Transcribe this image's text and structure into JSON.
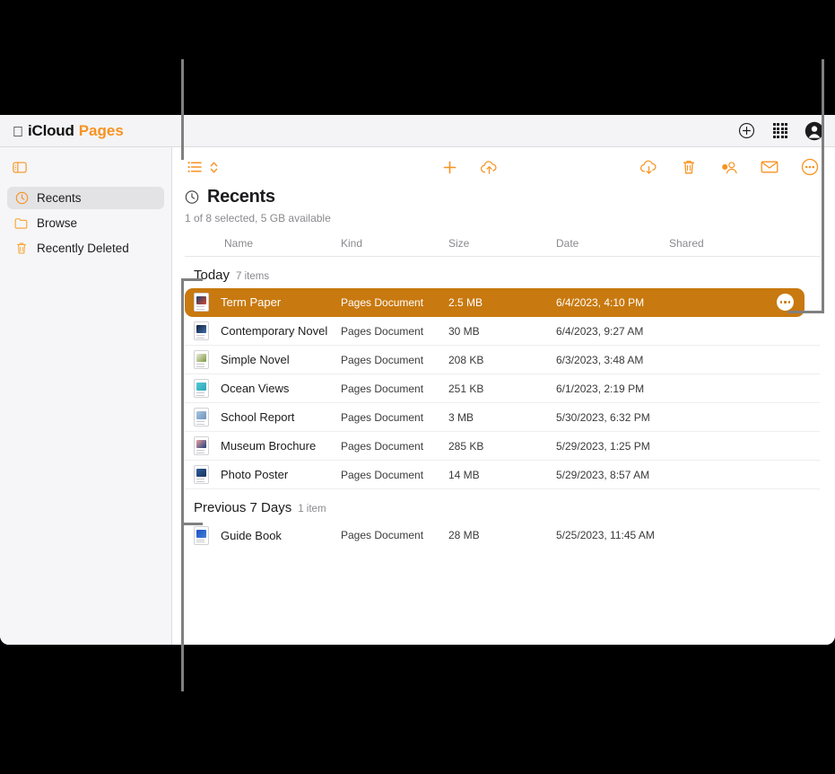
{
  "header": {
    "apple_logo": "",
    "brand_primary": "iCloud",
    "brand_app": "Pages",
    "icons": [
      {
        "name": "add-circle-icon",
        "label": "+"
      },
      {
        "name": "app-grid-icon",
        "label": "apps"
      },
      {
        "name": "account-avatar-icon",
        "label": "account"
      }
    ]
  },
  "sidebar": {
    "toggle_name": "sidebar-toggle-icon",
    "items": [
      {
        "label": "Recents",
        "icon": "clock-icon",
        "active": true
      },
      {
        "label": "Browse",
        "icon": "folder-icon",
        "active": false
      },
      {
        "label": "Recently Deleted",
        "icon": "trash-icon",
        "active": false
      }
    ]
  },
  "toolbar": {
    "left": [
      {
        "name": "list-view-icon",
        "label": "List view"
      },
      {
        "name": "sort-chevrons-icon",
        "label": "Sort"
      }
    ],
    "center": [
      {
        "name": "new-document-icon",
        "label": "+"
      },
      {
        "name": "cloud-upload-icon",
        "label": "Upload"
      }
    ],
    "right": [
      {
        "name": "cloud-download-icon",
        "label": "Download"
      },
      {
        "name": "delete-trash-icon",
        "label": "Delete"
      },
      {
        "name": "share-person-icon",
        "label": "Share"
      },
      {
        "name": "mail-envelope-icon",
        "label": "Mail"
      },
      {
        "name": "more-options-icon",
        "label": "More"
      }
    ]
  },
  "page": {
    "title": "Recents",
    "title_icon": "clock-icon",
    "subtitle": "1 of 8 selected, 5 GB available"
  },
  "columns": [
    "Name",
    "Kind",
    "Size",
    "Date",
    "Shared"
  ],
  "groups": [
    {
      "name": "Today",
      "count": "7 items",
      "files": [
        {
          "name": "Term Paper",
          "kind": "Pages Document",
          "size": "2.5 MB",
          "date": "6/4/2023, 4:10 PM",
          "shared": "",
          "selected": true,
          "thumb": "#1d3f6e",
          "thumb2": "#d4462f"
        },
        {
          "name": "Contemporary Novel",
          "kind": "Pages Document",
          "size": "30 MB",
          "date": "6/4/2023, 9:27 AM",
          "shared": "",
          "selected": false,
          "thumb": "#14213d",
          "thumb2": "#3b6ea8"
        },
        {
          "name": "Simple Novel",
          "kind": "Pages Document",
          "size": "208 KB",
          "date": "6/3/2023, 3:48 AM",
          "shared": "",
          "selected": false,
          "thumb": "#eceade",
          "thumb2": "#7a9a3a"
        },
        {
          "name": "Ocean Views",
          "kind": "Pages Document",
          "size": "251 KB",
          "date": "6/1/2023, 2:19 PM",
          "shared": "",
          "selected": false,
          "thumb": "#55c9d6",
          "thumb2": "#2aa7b8"
        },
        {
          "name": "School Report",
          "kind": "Pages Document",
          "size": "3 MB",
          "date": "5/30/2023, 6:32 PM",
          "shared": "",
          "selected": false,
          "thumb": "#aac6e0",
          "thumb2": "#6b93bd"
        },
        {
          "name": "Museum Brochure",
          "kind": "Pages Document",
          "size": "285 KB",
          "date": "5/29/2023, 1:25 PM",
          "shared": "",
          "selected": false,
          "thumb": "#e8a0a0",
          "thumb2": "#1f3f7a"
        },
        {
          "name": "Photo Poster",
          "kind": "Pages Document",
          "size": "14 MB",
          "date": "5/29/2023, 8:57 AM",
          "shared": "",
          "selected": false,
          "thumb": "#2f5c96",
          "thumb2": "#1a3560"
        }
      ]
    },
    {
      "name": "Previous 7 Days",
      "count": "1 item",
      "files": [
        {
          "name": "Guide Book",
          "kind": "Pages Document",
          "size": "28 MB",
          "date": "5/25/2023, 11:45 AM",
          "shared": "",
          "selected": false,
          "thumb": "#1f51c4",
          "thumb2": "#3f7fd8"
        }
      ]
    }
  ],
  "colors": {
    "accent": "#f79321",
    "selection": "#c8790f",
    "sidebar_bg": "#f6f6f8",
    "callout_line": "#808080"
  }
}
